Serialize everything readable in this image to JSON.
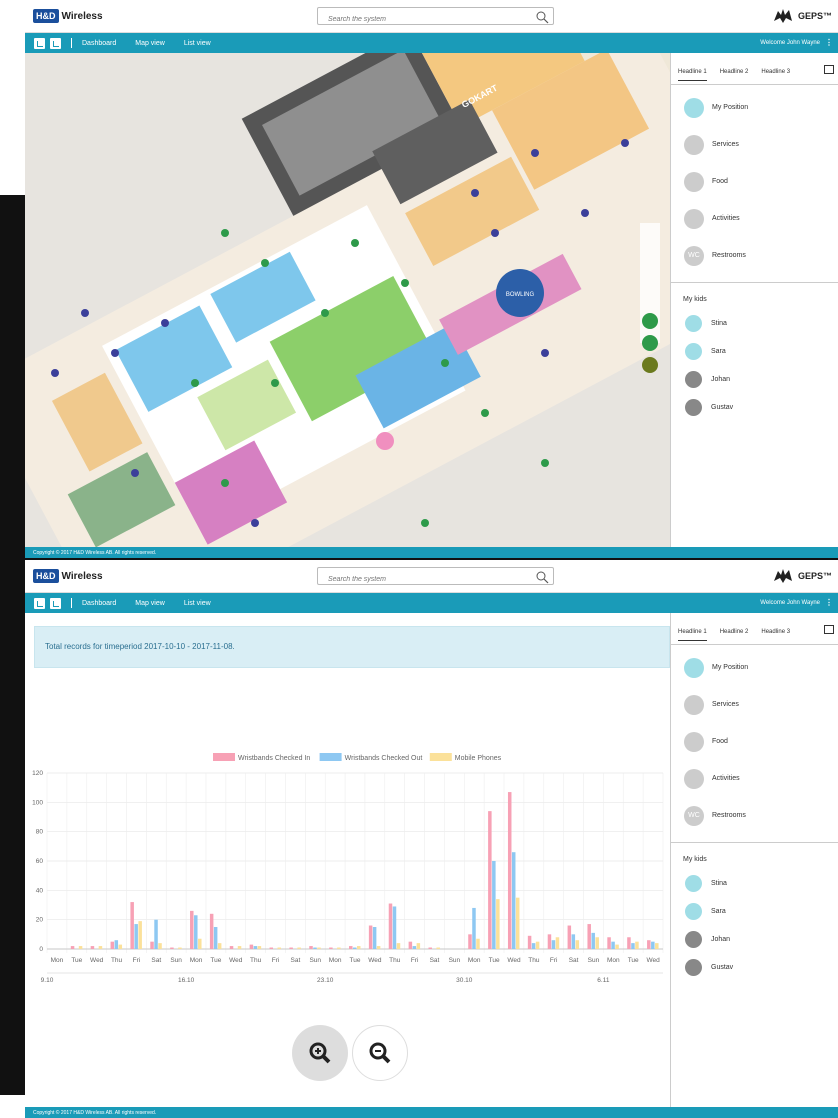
{
  "header": {
    "logo_box": "H&D",
    "logo_text": "Wireless",
    "search_placeholder": "Search the system",
    "brand": "GEPS™"
  },
  "nav": {
    "links": [
      "Dashboard",
      "Map view",
      "List view"
    ],
    "welcome": "Welcome John Wayne",
    "more": "⋮"
  },
  "sidebar": {
    "tabs": [
      "Headline 1",
      "Headline 2",
      "Headline 3"
    ],
    "pois": [
      {
        "label": "My Position",
        "icon": "person-icon"
      },
      {
        "label": "Services",
        "icon": "info-icon"
      },
      {
        "label": "Food",
        "icon": "cutlery-icon"
      },
      {
        "label": "Activities",
        "icon": "activity-icon"
      },
      {
        "label": "Restrooms",
        "icon": "wc-icon",
        "glyph": "WC"
      }
    ],
    "kids_heading": "My kids",
    "kids": [
      {
        "name": "Stina",
        "active": true
      },
      {
        "name": "Sara",
        "active": true
      },
      {
        "name": "Johan",
        "active": false
      },
      {
        "name": "Gustav",
        "active": false
      }
    ]
  },
  "footer": "Copyright © 2017 H&D Wireless AB. All rights reserved.",
  "map": {
    "labels": [
      "GOKART",
      "BOWLING"
    ]
  },
  "summary": "Total records for timeperiod 2017-10-10 - 2017-11-08.",
  "colors": {
    "teal": "#1a9bb8",
    "series_in": "#f7a1b5",
    "series_out": "#8ec8f2",
    "series_phones": "#fbe19a"
  },
  "chart_data": {
    "type": "bar",
    "categories": [
      "Mon",
      "Tue",
      "Wed",
      "Thu",
      "Fri",
      "Sat",
      "Sun",
      "Mon",
      "Tue",
      "Wed",
      "Thu",
      "Fri",
      "Sat",
      "Sun",
      "Mon",
      "Tue",
      "Wed",
      "Thu",
      "Fri",
      "Sat",
      "Sun",
      "Mon",
      "Tue",
      "Wed",
      "Thu",
      "Fri",
      "Sat",
      "Sun",
      "Mon",
      "Tue",
      "Wed"
    ],
    "date_ticks": [
      "9.10",
      "16.10",
      "23.10",
      "30.10",
      "6.11"
    ],
    "series": [
      {
        "name": "Wristbands Checked In",
        "color": "#f7a1b5",
        "values": [
          0,
          2,
          2,
          5,
          32,
          5,
          1,
          26,
          24,
          2,
          3,
          1,
          1,
          2,
          1,
          2,
          16,
          31,
          5,
          1,
          0,
          10,
          94,
          107,
          9,
          10,
          16,
          17,
          8,
          8,
          6
        ]
      },
      {
        "name": "Wristbands Checked Out",
        "color": "#8ec8f2",
        "values": [
          0,
          0,
          0,
          6,
          17,
          20,
          0,
          23,
          15,
          0,
          2,
          0,
          0,
          1,
          0,
          1,
          15,
          29,
          2,
          0,
          0,
          28,
          60,
          66,
          4,
          6,
          10,
          11,
          5,
          4,
          5
        ]
      },
      {
        "name": "Mobile Phones",
        "color": "#fbe19a",
        "values": [
          0,
          2,
          2,
          3,
          19,
          4,
          1,
          7,
          4,
          2,
          2,
          1,
          1,
          1,
          1,
          2,
          2,
          4,
          4,
          1,
          0,
          7,
          34,
          35,
          5,
          8,
          6,
          8,
          3,
          5,
          4
        ]
      }
    ],
    "ylim": [
      0,
      120
    ],
    "yticks": [
      0,
      20,
      40,
      60,
      80,
      100,
      120
    ],
    "grid": true,
    "legend": "top"
  }
}
